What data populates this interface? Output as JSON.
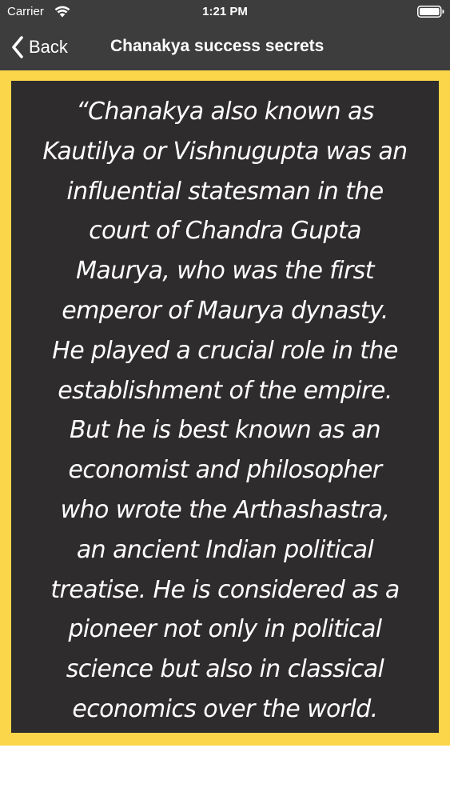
{
  "status_bar": {
    "carrier": "Carrier",
    "time": "1:21 PM",
    "wifi_icon": "wifi-icon",
    "battery_icon": "battery-icon"
  },
  "nav_bar": {
    "back_label": "Back",
    "back_icon": "chevron-left-icon",
    "title": "Chanakya success secrets"
  },
  "colors": {
    "bar_background": "#3d3d3d",
    "frame_yellow": "#fbd54a",
    "card_background": "#2e2c2c",
    "text": "#ffffff"
  },
  "quote": {
    "lines": [
      "“Chanakya also known as",
      "Kautilya or Vishnugupta was an",
      "influential statesman in the",
      "court of Chandra Gupta",
      "Maurya, who was the first",
      "emperor of Maurya dynasty.",
      "He played a crucial role in the",
      "establishment of the empire.",
      "But he is best known as an",
      "economist and philosopher",
      "who wrote the Arthashastra,",
      "an ancient Indian political",
      "treatise. He is considered as a",
      "pioneer not only in political",
      "science but also in classical",
      "economics over the world."
    ]
  }
}
